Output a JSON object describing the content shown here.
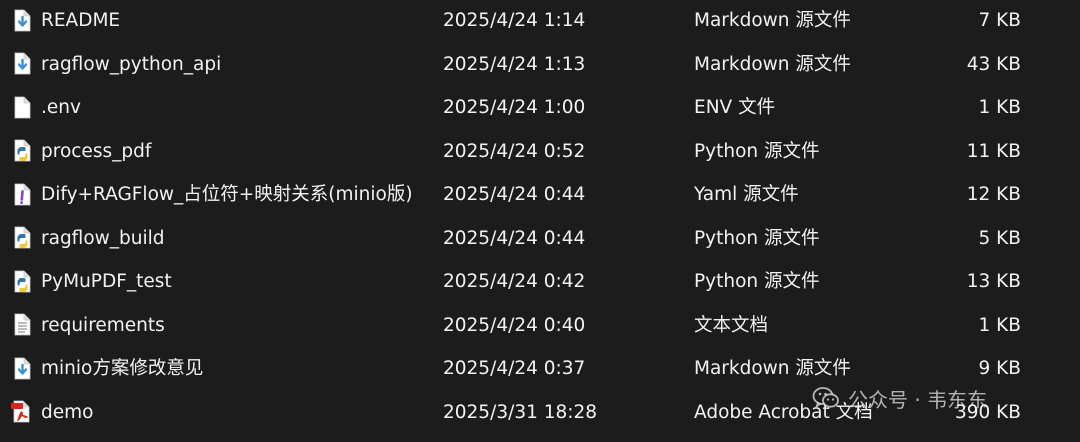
{
  "files": [
    {
      "icon": "markdown-file-icon",
      "name": "README",
      "date": "2025/4/24 1:14",
      "type": "Markdown 源文件",
      "size": "7 KB"
    },
    {
      "icon": "markdown-file-icon",
      "name": "ragflow_python_api",
      "date": "2025/4/24 1:13",
      "type": "Markdown 源文件",
      "size": "43 KB"
    },
    {
      "icon": "blank-file-icon",
      "name": ".env",
      "date": "2025/4/24 1:00",
      "type": "ENV 文件",
      "size": "1 KB"
    },
    {
      "icon": "python-file-icon",
      "name": "process_pdf",
      "date": "2025/4/24 0:52",
      "type": "Python 源文件",
      "size": "11 KB"
    },
    {
      "icon": "yaml-file-icon",
      "name": "Dify+RAGFlow_占位符+映射关系(minio版)",
      "date": "2025/4/24 0:44",
      "type": "Yaml 源文件",
      "size": "12 KB"
    },
    {
      "icon": "python-file-icon",
      "name": "ragflow_build",
      "date": "2025/4/24 0:44",
      "type": "Python 源文件",
      "size": "5 KB"
    },
    {
      "icon": "python-file-icon",
      "name": "PyMuPDF_test",
      "date": "2025/4/24 0:42",
      "type": "Python 源文件",
      "size": "13 KB"
    },
    {
      "icon": "text-file-icon",
      "name": "requirements",
      "date": "2025/4/24 0:40",
      "type": "文本文档",
      "size": "1 KB"
    },
    {
      "icon": "markdown-file-icon",
      "name": "minio方案修改意见",
      "date": "2025/4/24 0:37",
      "type": "Markdown 源文件",
      "size": "9 KB"
    },
    {
      "icon": "pdf-file-icon",
      "name": "demo",
      "date": "2025/3/31 18:28",
      "type": "Adobe Acrobat 文档",
      "size": "390 KB"
    }
  ],
  "watermark": {
    "icon": "wechat-icon",
    "text": "公众号 · 韦东东"
  },
  "colors": {
    "background": "#1c1c1c",
    "text": "#f2f2f2",
    "markdown_arrow": "#3d8fd6",
    "python_blue": "#3572a5",
    "python_yellow": "#f0c93a",
    "yaml_purple": "#8a3fd1",
    "pdf_red": "#d9261c"
  }
}
